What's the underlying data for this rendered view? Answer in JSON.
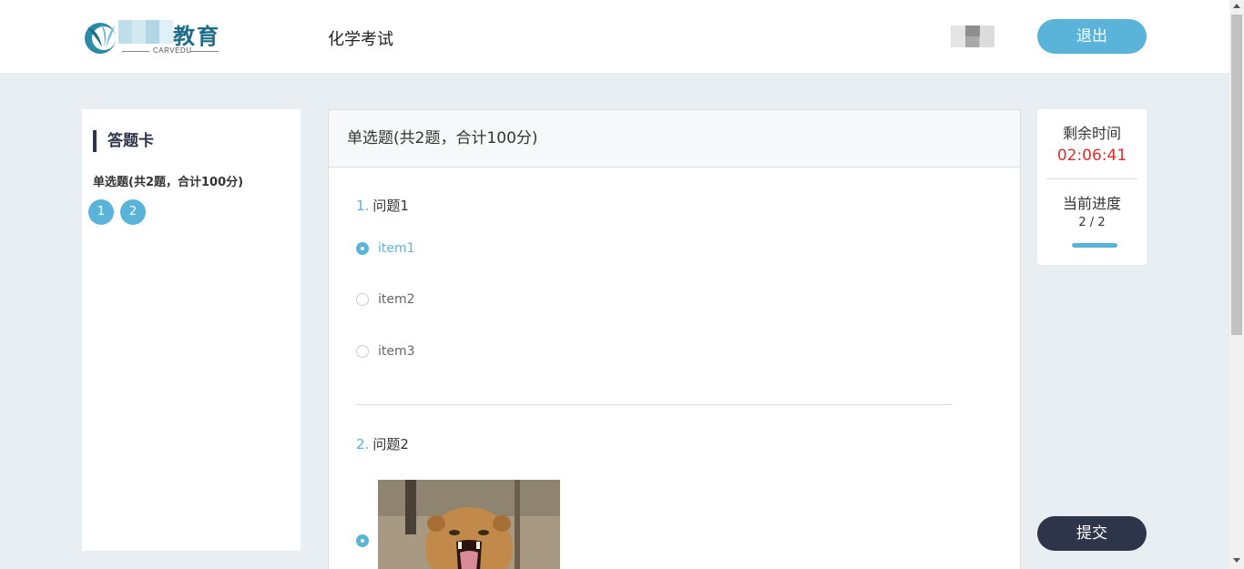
{
  "header": {
    "logo_text": "教育",
    "logo_sub": "CARVEDU",
    "exam_title": "化学考试",
    "logout_label": "退出"
  },
  "answer_card": {
    "title": "答题卡",
    "section": "单选题(共2题，合计100分)",
    "questions": [
      "1",
      "2"
    ]
  },
  "main": {
    "section_title": "单选题(共2题，合计100分)",
    "questions": [
      {
        "num": "1.",
        "title": "问题1",
        "options": [
          {
            "label": "item1",
            "selected": true
          },
          {
            "label": "item2",
            "selected": false
          },
          {
            "label": "item3",
            "selected": false
          }
        ]
      },
      {
        "num": "2.",
        "title": "问题2",
        "options": [
          {
            "label": "",
            "selected": true,
            "image": "lion-image"
          }
        ]
      }
    ]
  },
  "timer": {
    "remaining_label": "剩余时间",
    "remaining_value": "02:06:41",
    "progress_label": "当前进度",
    "progress_current": "2",
    "progress_sep": "/",
    "progress_total": "2",
    "progress_fraction": 1.0
  },
  "submit_label": "提交",
  "colors": {
    "accent": "#5ab4d9",
    "dark": "#2e3449",
    "timer_red": "#e62b2b",
    "background": "#e9eef3"
  }
}
